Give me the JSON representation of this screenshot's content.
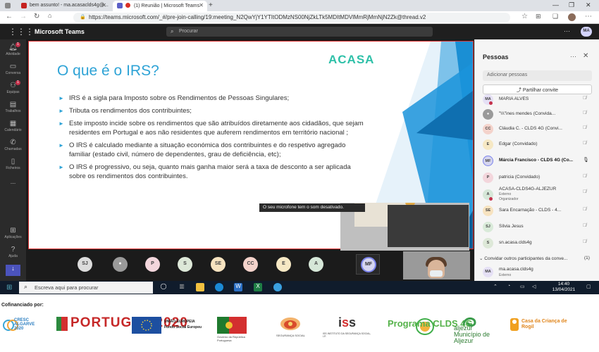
{
  "browser": {
    "tabs": [
      {
        "label": ""
      },
      {
        "label": "bem assunto! - ma.acasaclds4g@..."
      },
      {
        "label": "(1) Reunião | Microsoft Teams"
      }
    ],
    "url": "https://teams.microsoft.com/_#/pre-join-calling/19:meeting_N2QwYjY1YTItODMzNS00NjZkLTk5MDItMDVlMmRjMmNjN2Zk@thread.v2",
    "lock_icon": "lock-icon",
    "profile_icon": "profile-icon"
  },
  "teams": {
    "app_title": "Microsoft Teams",
    "search_placeholder": "Procurar",
    "user_initials": "MA",
    "rail": [
      {
        "label": "Atividade",
        "icon": "bell-icon",
        "badge": "1"
      },
      {
        "label": "Conversa",
        "icon": "chat-icon",
        "badge": ""
      },
      {
        "label": "Equipas",
        "icon": "teams-icon",
        "badge": "1"
      },
      {
        "label": "Trabalhos",
        "icon": "assignments-icon",
        "badge": ""
      },
      {
        "label": "Calendário",
        "icon": "calendar-icon",
        "badge": ""
      },
      {
        "label": "Chamadas",
        "icon": "phone-icon",
        "badge": ""
      },
      {
        "label": "Ficheiros",
        "icon": "files-icon",
        "badge": ""
      },
      {
        "label": "...",
        "icon": "more-icon",
        "badge": ""
      },
      {
        "label": "Aplicações",
        "icon": "apps-icon",
        "badge": ""
      },
      {
        "label": "Ajuda",
        "icon": "help-icon",
        "badge": ""
      }
    ]
  },
  "slide": {
    "title": "O que é o IRS?",
    "logo_text": "ACASA",
    "bullets": [
      "IRS é a sigla para Imposto sobre os Rendimentos de Pessoas Singulares;",
      "Tributa os rendimentos dos contribuintes;",
      "Este imposto incide sobre os rendimentos que são atribuídos diretamente aos cidadãos, que sejam residentes em Portugal e aos não residentes que auferem rendimentos em território nacional ;",
      "O IRS é calculado mediante a situação económica dos contribuintes e do respetivo agregado familiar (estado civil, número de dependentes, grau de deficiência, etc);",
      "O IRS é progressivo, ou seja, quanto mais ganha maior será a taxa de desconto a ser aplicada sobre os rendimentos dos contribuintes."
    ]
  },
  "meeting": {
    "mic_toast": "O seu microfone tem o som desativado.",
    "participants_bubbles": [
      {
        "initials": "SJ",
        "color": "#dcdcdc"
      },
      {
        "initials": "",
        "color": "#9a9a9a"
      },
      {
        "initials": "P",
        "color": "#f3d6dc"
      },
      {
        "initials": "S",
        "color": "#dde8d8"
      },
      {
        "initials": "SE",
        "color": "#f7e3c0"
      },
      {
        "initials": "CC",
        "color": "#f4d3cb"
      },
      {
        "initials": "E",
        "color": "#f6e8c4"
      },
      {
        "initials": "A",
        "color": "#d6e7d8"
      }
    ],
    "active_speaker": "MF"
  },
  "panel": {
    "title": "Pessoas",
    "add_people": "Adicionar pessoas",
    "share_invite": "Partilhar convite",
    "participants": [
      {
        "initials": "MA",
        "name": "MARIA ALVES",
        "sub": "",
        "color": "#e5e0f5",
        "bold": false
      },
      {
        "initials": "",
        "name": "\"\\\\\\\"ines mendes (Convida...",
        "sub": "",
        "color": "#9a9a9a",
        "bold": false
      },
      {
        "initials": "CC",
        "name": "Cláudia C. - CLDS 4G (Convi...",
        "sub": "",
        "color": "#f4d3cb",
        "bold": false
      },
      {
        "initials": "E",
        "name": "Edgar (Convidado)",
        "sub": "",
        "color": "#f6e8c4",
        "bold": false
      },
      {
        "initials": "MF",
        "name": "Márcia Francisco - CLDS 4G (Co...",
        "sub": "",
        "color": "#d6d6f0",
        "bold": true
      },
      {
        "initials": "P",
        "name": "patricia (Convidado)",
        "sub": "",
        "color": "#f3d6dc",
        "bold": false
      },
      {
        "initials": "A",
        "name": "ACASA-CLDS4G-ALJEZUR",
        "sub": "Externo\nOrganizador",
        "color": "#d6e7d8",
        "bold": false
      },
      {
        "initials": "SE",
        "name": "Sara Encarnação - CLDS - 4...",
        "sub": "",
        "color": "#f7e3c0",
        "bold": false
      },
      {
        "initials": "SJ",
        "name": "Sílvia Jesus",
        "sub": "",
        "color": "#d9ead9",
        "bold": false
      },
      {
        "initials": "S",
        "name": "sn.acasa.clds4g",
        "sub": "",
        "color": "#dde8d8",
        "bold": false
      }
    ],
    "others_label": "Convidar outros participantes da conve...",
    "others_count": "(1)",
    "invitee": {
      "initials": "MA",
      "name": "ma.acasa.clds4g",
      "sub": "Externo"
    }
  },
  "taskbar": {
    "search_placeholder": "Escreva aqui para procurar",
    "time": "14:40",
    "date": "13/04/2021"
  },
  "footer": {
    "cofinanciado": "Cofinanciado por:",
    "logos": [
      {
        "name": "cresc-algarve",
        "text": "CRESC ALGARVE 2020"
      },
      {
        "name": "portugal-2020",
        "text": "PORTUGAL 2020"
      },
      {
        "name": "uniao-europeia",
        "text": "UNIÃO EUROPEIA\nFundo Social Europeu"
      },
      {
        "name": "governo",
        "text": "Governo da República Portuguesa"
      },
      {
        "name": "seguranca-social",
        "text": "SEGURANÇA SOCIAL"
      },
      {
        "name": "iss",
        "text": "ISS INSTITUTO DA SEGURANÇA SOCIAL, I.P."
      },
      {
        "name": "clds-4g",
        "text": "Programa CLDS 4G"
      },
      {
        "name": "aljezur",
        "text": "aljezur\nMunicípio de Aljezur"
      },
      {
        "name": "casa-crianca",
        "text": "Casa da Criança de Rogil"
      }
    ]
  },
  "colors": {
    "teams_accent": "#4b53bc",
    "slide_title": "#2ea3d6",
    "muted_red": "#c4314b"
  }
}
